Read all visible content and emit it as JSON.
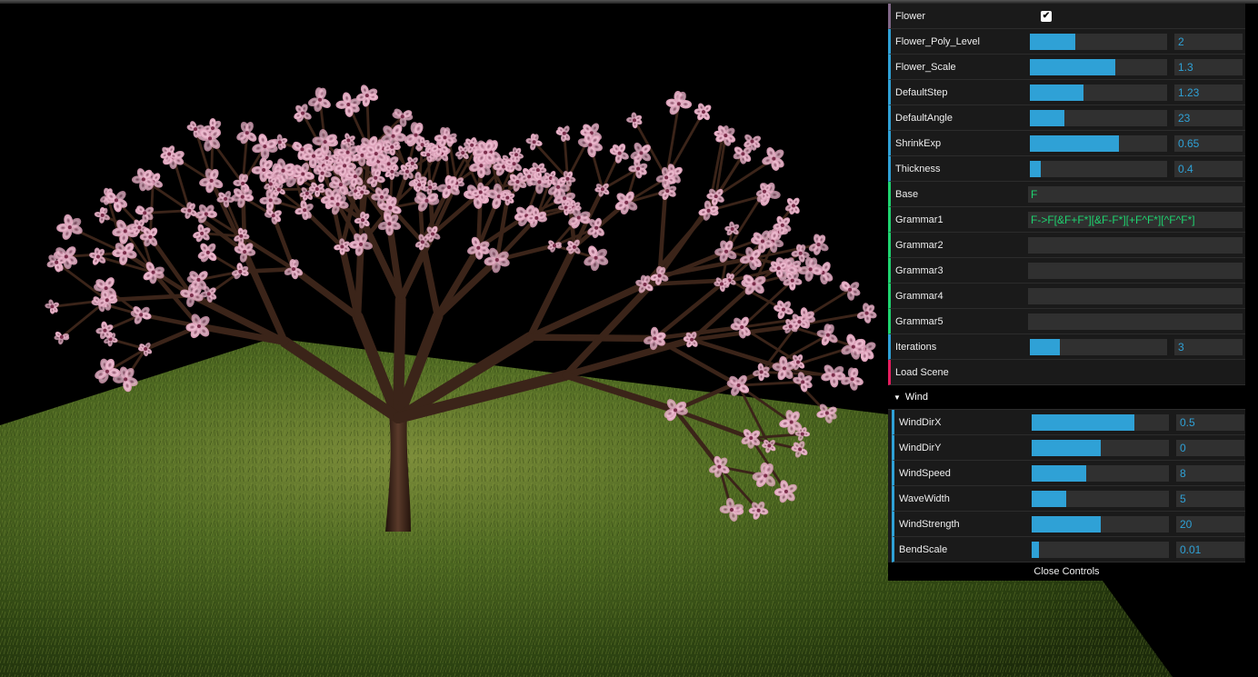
{
  "controls": {
    "flower": {
      "label": "Flower",
      "checked": true,
      "check_mark": "✔"
    },
    "sliders": [
      {
        "label": "Flower_Poly_Level",
        "value": "2",
        "fill": 0.33
      },
      {
        "label": "Flower_Scale",
        "value": "1.3",
        "fill": 0.62
      },
      {
        "label": "DefaultStep",
        "value": "1.23",
        "fill": 0.39
      },
      {
        "label": "DefaultAngle",
        "value": "23",
        "fill": 0.25
      },
      {
        "label": "ShrinkExp",
        "value": "0.65",
        "fill": 0.65
      },
      {
        "label": "Thickness",
        "value": "0.4",
        "fill": 0.08
      }
    ],
    "strings": [
      {
        "label": "Base",
        "value": "F"
      },
      {
        "label": "Grammar1",
        "value": "F->F[&F+F*][&F-F*][+F^F*][^F^F*]"
      },
      {
        "label": "Grammar2",
        "value": ""
      },
      {
        "label": "Grammar3",
        "value": ""
      },
      {
        "label": "Grammar4",
        "value": ""
      },
      {
        "label": "Grammar5",
        "value": ""
      }
    ],
    "iterations": {
      "label": "Iterations",
      "value": "3",
      "fill": 0.22
    },
    "load_scene": {
      "label": "Load Scene"
    },
    "wind_folder": {
      "title": "Wind",
      "sliders": [
        {
          "label": "WindDirX",
          "value": "0.5",
          "fill": 0.75
        },
        {
          "label": "WindDirY",
          "value": "0",
          "fill": 0.5
        },
        {
          "label": "WindSpeed",
          "value": "8",
          "fill": 0.4
        },
        {
          "label": "WaveWidth",
          "value": "5",
          "fill": 0.25
        },
        {
          "label": "WindStrength",
          "value": "20",
          "fill": 0.5
        },
        {
          "label": "BendScale",
          "value": "0.01",
          "fill": 0.05
        }
      ]
    },
    "close_label": "Close Controls"
  },
  "colors": {
    "number_accent": "#2fa1d6",
    "string_accent": "#1ed36f",
    "function_accent": "#e61d5f",
    "boolean_accent": "#806787",
    "blossom": "#f4c6d8",
    "branch": "#3b2419",
    "grass": "#4d6a22"
  }
}
